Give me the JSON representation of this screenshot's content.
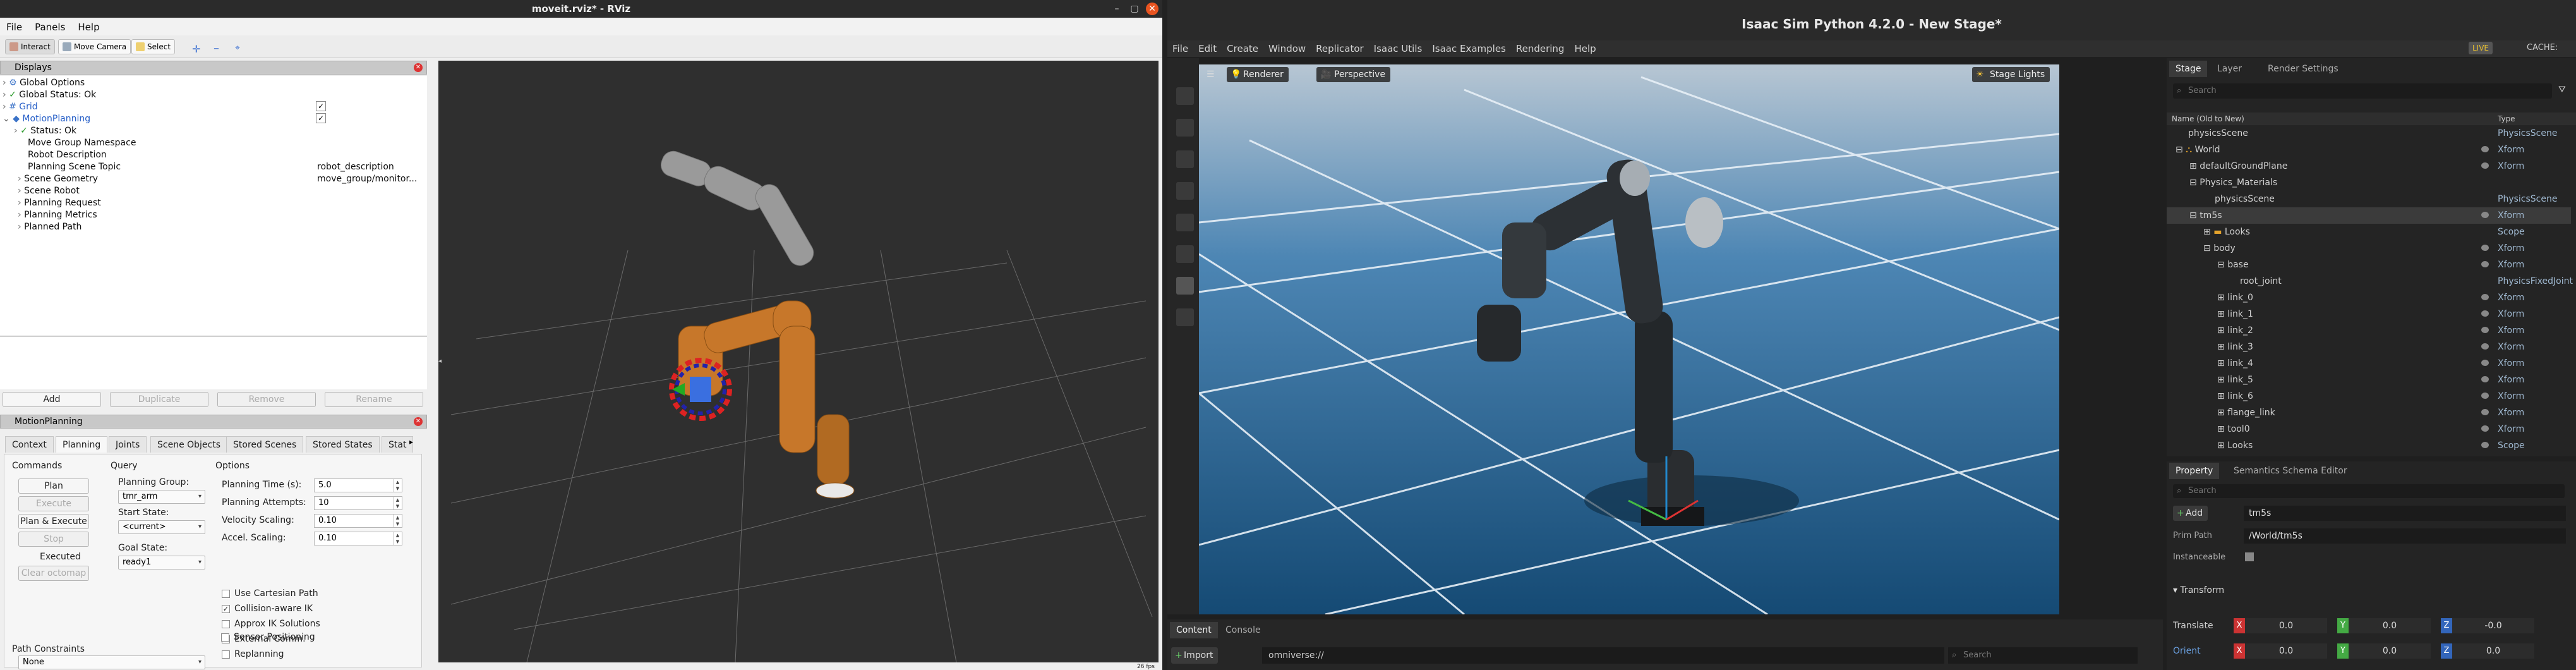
{
  "rviz": {
    "window_title": "moveit.rviz* - RViz",
    "menu": [
      "File",
      "Panels",
      "Help"
    ],
    "toolbar": {
      "interact": "Interact",
      "move_camera": "Move Camera",
      "select": "Select"
    },
    "displays": {
      "title": "Displays",
      "tree": [
        {
          "label": "Global Options",
          "indent": 0,
          "value": ""
        },
        {
          "label": "Global Status: Ok",
          "indent": 0,
          "value": ""
        },
        {
          "label": "Grid",
          "indent": 0,
          "value": ""
        },
        {
          "label": "MotionPlanning",
          "indent": 0,
          "value": ""
        },
        {
          "label": "Status: Ok",
          "indent": 1,
          "value": ""
        },
        {
          "label": "Move Group Namespace",
          "indent": 1,
          "value": ""
        },
        {
          "label": "Robot Description",
          "indent": 1,
          "value": "robot_description"
        },
        {
          "label": "Planning Scene Topic",
          "indent": 1,
          "value": "move_group/monitor..."
        },
        {
          "label": "Scene Geometry",
          "indent": 1,
          "value": ""
        },
        {
          "label": "Scene Robot",
          "indent": 1,
          "value": ""
        },
        {
          "label": "Planning Request",
          "indent": 1,
          "value": ""
        },
        {
          "label": "Planning Metrics",
          "indent": 1,
          "value": ""
        },
        {
          "label": "Planned Path",
          "indent": 1,
          "value": ""
        }
      ],
      "buttons": {
        "add": "Add",
        "duplicate": "Duplicate",
        "remove": "Remove",
        "rename": "Rename"
      }
    },
    "motion_planning": {
      "title": "MotionPlanning",
      "tabs": [
        "Context",
        "Planning",
        "Joints",
        "Scene Objects",
        "Stored Scenes",
        "Stored States",
        "Stat"
      ],
      "commands_label": "Commands",
      "query_label": "Query",
      "options_label": "Options",
      "buttons": {
        "plan": "Plan",
        "execute": "Execute",
        "plan_execute": "Plan & Execute",
        "stop": "Stop",
        "executed": "Executed",
        "clear_octomap": "Clear octomap"
      },
      "planning_group_label": "Planning Group:",
      "planning_group": "tmr_arm",
      "start_state_label": "Start State:",
      "start_state": "<current>",
      "goal_state_label": "Goal State:",
      "goal_state": "ready1",
      "planning_time_label": "Planning Time (s):",
      "planning_time": "5.0",
      "planning_attempts_label": "Planning Attempts:",
      "planning_attempts": "10",
      "velocity_scaling_label": "Velocity Scaling:",
      "velocity_scaling": "0.10",
      "accel_scaling_label": "Accel. Scaling:",
      "accel_scaling": "0.10",
      "checkboxes": [
        {
          "label": "Use Cartesian Path",
          "checked": false
        },
        {
          "label": "Collision-aware IK",
          "checked": true
        },
        {
          "label": "Approx IK Solutions",
          "checked": false
        },
        {
          "label": "External Comm.",
          "checked": false
        },
        {
          "label": "Replanning",
          "checked": false
        },
        {
          "label": "Sensor Positioning",
          "checked": false
        }
      ],
      "path_constraints_label": "Path Constraints",
      "path_constraints": "None"
    },
    "fps": "26 fps"
  },
  "isaac": {
    "window_title": "Isaac Sim Python 4.2.0 - New Stage*",
    "menu": [
      "File",
      "Edit",
      "Create",
      "Window",
      "Replicator",
      "Isaac Utils",
      "Isaac Examples",
      "Rendering",
      "Help"
    ],
    "live": "LIVE",
    "cache": "CACHE:",
    "viewport": {
      "renderer": "Renderer",
      "camera": "Perspective",
      "stage_lights": "Stage Lights"
    },
    "stage_tabs": [
      "Stage",
      "Layer",
      "Render Settings"
    ],
    "search_placeholder": "Search",
    "stage_columns": {
      "name": "Name (Old to New)",
      "type": "Type"
    },
    "stage_rows": [
      {
        "name": "physicsScene",
        "indent": 0,
        "type": "PhysicsScene"
      },
      {
        "name": "World",
        "indent": 0,
        "type": "Xform"
      },
      {
        "name": "defaultGroundPlane",
        "indent": 1,
        "type": "Xform"
      },
      {
        "name": "Physics_Materials",
        "indent": 1,
        "type": ""
      },
      {
        "name": "physicsScene",
        "indent": 2,
        "type": "PhysicsScene"
      },
      {
        "name": "tm5s",
        "indent": 1,
        "type": "Xform"
      },
      {
        "name": "Looks",
        "indent": 2,
        "type": "Scope"
      },
      {
        "name": "body",
        "indent": 2,
        "type": "Xform"
      },
      {
        "name": "base",
        "indent": 3,
        "type": "Xform"
      },
      {
        "name": "root_joint",
        "indent": 4,
        "type": "PhysicsFixedJoint"
      },
      {
        "name": "link_0",
        "indent": 3,
        "type": "Xform"
      },
      {
        "name": "link_1",
        "indent": 3,
        "type": "Xform"
      },
      {
        "name": "link_2",
        "indent": 3,
        "type": "Xform"
      },
      {
        "name": "link_3",
        "indent": 3,
        "type": "Xform"
      },
      {
        "name": "link_4",
        "indent": 3,
        "type": "Xform"
      },
      {
        "name": "link_5",
        "indent": 3,
        "type": "Xform"
      },
      {
        "name": "link_6",
        "indent": 3,
        "type": "Xform"
      },
      {
        "name": "flange_link",
        "indent": 3,
        "type": "Xform"
      },
      {
        "name": "tool0",
        "indent": 3,
        "type": "Xform"
      },
      {
        "name": "Looks",
        "indent": 3,
        "type": "Scope"
      }
    ],
    "property_tabs": [
      "Property",
      "Semantics Schema Editor"
    ],
    "add_button": "Add",
    "prim_name": "tm5s",
    "prim_path_label": "Prim Path",
    "prim_path": "/World/tm5s",
    "instanceable_label": "Instanceable",
    "transform_label": "Transform",
    "translate_label": "Translate",
    "translate": {
      "x": "0.0",
      "y": "0.0",
      "z": "-0.0"
    },
    "orient_label": "Orient",
    "orient": {
      "x": "0.0",
      "y": "0.0",
      "z": "0.0"
    },
    "bottom_tabs": [
      "Content",
      "Console"
    ],
    "import_button": "Import",
    "content_path": "omniverse://"
  }
}
